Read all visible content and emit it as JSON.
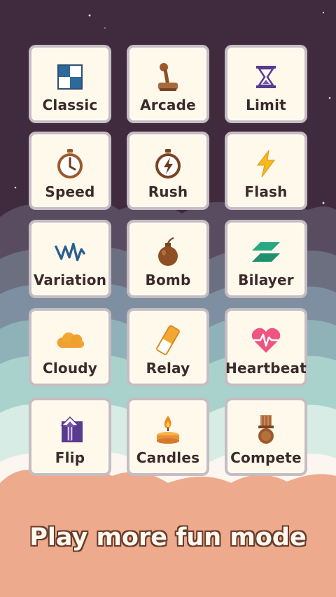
{
  "colors": {
    "night_sky": "#3f2a3e",
    "tile_bg": "#fff9ec",
    "label_text": "#3b2a2a",
    "footer_text": "#fff9ef",
    "footer_outline": "#6a3c2a"
  },
  "modes": [
    {
      "label": "Classic",
      "icon": "checkerboard-icon"
    },
    {
      "label": "Arcade",
      "icon": "joystick-icon"
    },
    {
      "label": "Limit",
      "icon": "hourglass-icon"
    },
    {
      "label": "Speed",
      "icon": "stopwatch-icon"
    },
    {
      "label": "Rush",
      "icon": "lightning-stopwatch-icon"
    },
    {
      "label": "Flash",
      "icon": "lightning-icon"
    },
    {
      "label": "Variation",
      "icon": "wave-icon"
    },
    {
      "label": "Bomb",
      "icon": "bomb-icon"
    },
    {
      "label": "Bilayer",
      "icon": "layers-icon"
    },
    {
      "label": "Cloudy",
      "icon": "cloud-icon"
    },
    {
      "label": "Relay",
      "icon": "baton-icon"
    },
    {
      "label": "Heartbeat",
      "icon": "heartbeat-icon"
    },
    {
      "label": "Flip",
      "icon": "flip-arrow-icon"
    },
    {
      "label": "Candles",
      "icon": "candle-icon"
    },
    {
      "label": "Compete",
      "icon": "medal-icon"
    }
  ],
  "footer": {
    "text": "Play more fun mode"
  }
}
